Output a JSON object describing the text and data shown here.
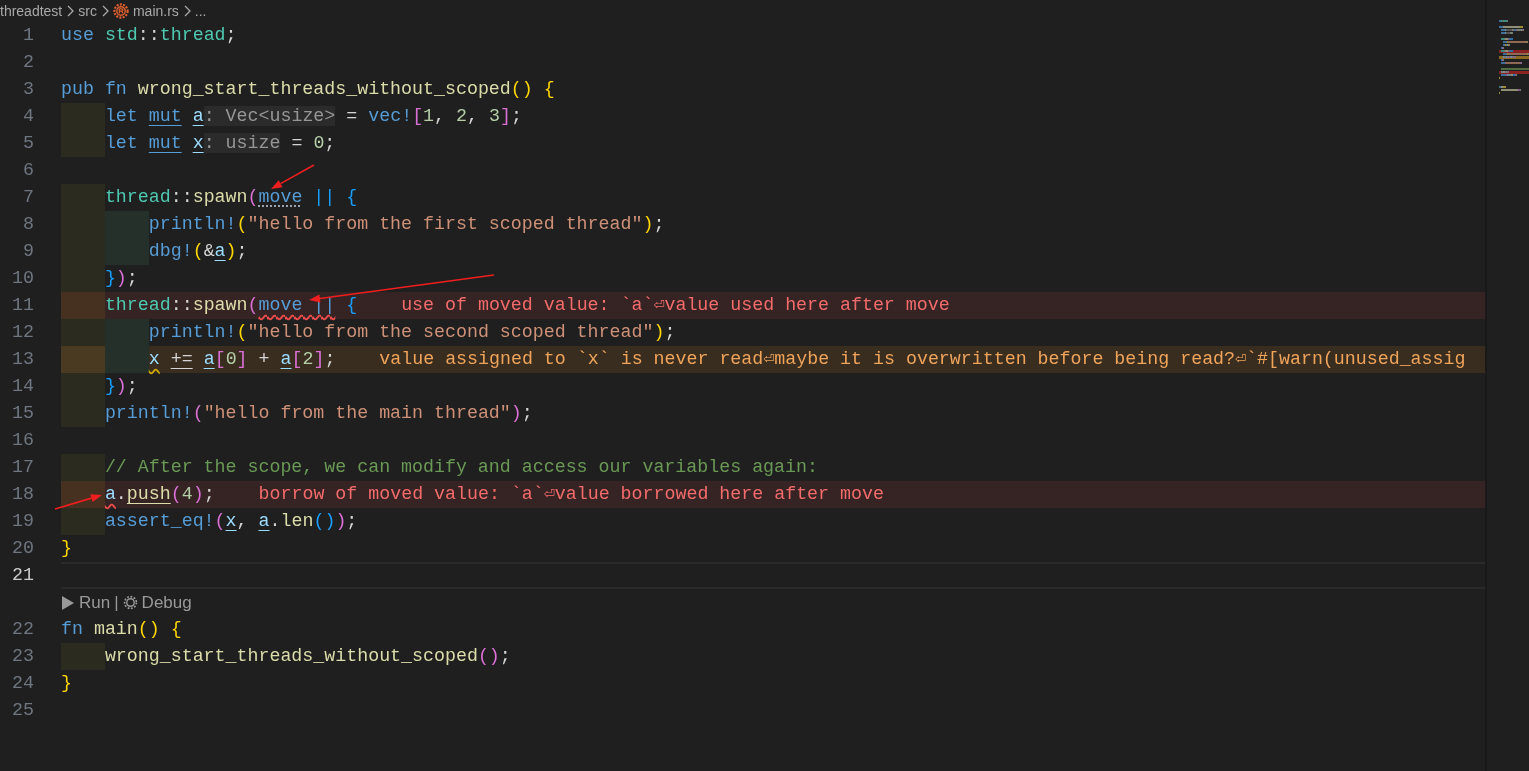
{
  "breadcrumb": [
    {
      "text": "threadtest",
      "kind": "root"
    },
    {
      "text": "src",
      "kind": "plain"
    },
    {
      "text": "main.rs",
      "kind": "rust"
    },
    {
      "text": "...",
      "kind": "plain"
    }
  ],
  "lines": [
    {
      "kind": "code",
      "number": "1",
      "current": false,
      "tokens": [
        {
          "text": "use ",
          "kind": "kw"
        },
        {
          "text": "std",
          "kind": "ns"
        },
        {
          "text": "::",
          "kind": "p"
        },
        {
          "text": "thread",
          "kind": "ns"
        },
        {
          "text": ";",
          "kind": "p"
        }
      ]
    },
    {
      "kind": "code",
      "number": "2",
      "current": false
    },
    {
      "kind": "code",
      "number": "3",
      "current": false,
      "tokens": [
        {
          "text": "pub fn ",
          "kind": "kw"
        },
        {
          "text": "wrong_start_threads_without_scoped",
          "kind": "fn"
        },
        {
          "text": "(",
          "kind": "b1"
        },
        {
          "text": ")",
          "kind": "b1"
        },
        {
          "text": " {",
          "kind": "b1"
        }
      ]
    },
    {
      "kind": "code",
      "number": "4",
      "current": false,
      "indent_guides": [
        {
          "color": "#2c2b20"
        }
      ],
      "tokens": [
        {
          "text": "let ",
          "kind": "kw"
        },
        {
          "text": "mut ",
          "kind": "kw",
          "decoration": {
            "kind": "underline"
          }
        },
        {
          "text": "a",
          "kind": "var",
          "decoration": {
            "kind": "underline"
          }
        },
        {
          "text": ": Vec<usize>",
          "kind": "hint"
        },
        {
          "text": " = ",
          "kind": "p"
        },
        {
          "text": "vec!",
          "kind": "mac"
        },
        {
          "text": "[",
          "kind": "b2"
        },
        {
          "text": "1",
          "kind": "num"
        },
        {
          "text": ", ",
          "kind": "p"
        },
        {
          "text": "2",
          "kind": "num"
        },
        {
          "text": ", ",
          "kind": "p"
        },
        {
          "text": "3",
          "kind": "num"
        },
        {
          "text": "]",
          "kind": "b2"
        },
        {
          "text": ";",
          "kind": "p"
        }
      ]
    },
    {
      "kind": "code",
      "number": "5",
      "current": false,
      "indent_guides": [
        {
          "color": "#2c2b20"
        }
      ],
      "tokens": [
        {
          "text": "let ",
          "kind": "kw"
        },
        {
          "text": "mut ",
          "kind": "kw",
          "decoration": {
            "kind": "underline"
          }
        },
        {
          "text": "x",
          "kind": "var",
          "decoration": {
            "kind": "underline"
          }
        },
        {
          "text": ": usize",
          "kind": "hint"
        },
        {
          "text": " = ",
          "kind": "p"
        },
        {
          "text": "0",
          "kind": "num"
        },
        {
          "text": ";",
          "kind": "p"
        }
      ]
    },
    {
      "kind": "code",
      "number": "6",
      "current": false
    },
    {
      "kind": "code",
      "number": "7",
      "current": false,
      "indent_guides": [
        {
          "color": "#2c2b20"
        }
      ],
      "tokens": [
        {
          "text": "thread",
          "kind": "ns"
        },
        {
          "text": "::",
          "kind": "p"
        },
        {
          "text": "spawn",
          "kind": "fn"
        },
        {
          "text": "(",
          "kind": "b2"
        },
        {
          "text": "move",
          "kind": "kw",
          "decoration": {
            "kind": "dots"
          },
          "arrow": true
        },
        {
          "text": " ||",
          "kind": "b3"
        },
        {
          "text": " {",
          "kind": "b3"
        }
      ]
    },
    {
      "kind": "code",
      "number": "8",
      "current": false,
      "indent_guides": [
        {
          "color": "#2c2b20"
        },
        {
          "color": "#25302a"
        }
      ],
      "tokens": [
        {
          "text": "println!",
          "kind": "mac"
        },
        {
          "text": "(",
          "kind": "b1"
        },
        {
          "text": "\"hello from the first scoped thread\"",
          "kind": "str"
        },
        {
          "text": ")",
          "kind": "b1"
        },
        {
          "text": ";",
          "kind": "p"
        }
      ]
    },
    {
      "kind": "code",
      "number": "9",
      "current": false,
      "indent_guides": [
        {
          "color": "#2c2b20"
        },
        {
          "color": "#25302a"
        }
      ],
      "tokens": [
        {
          "text": "dbg!",
          "kind": "mac"
        },
        {
          "text": "(",
          "kind": "b1"
        },
        {
          "text": "&",
          "kind": "p"
        },
        {
          "text": "a",
          "kind": "var",
          "decoration": {
            "kind": "underline"
          }
        },
        {
          "text": ")",
          "kind": "b1"
        },
        {
          "text": ";",
          "kind": "p"
        }
      ]
    },
    {
      "kind": "code",
      "number": "10",
      "current": false,
      "indent_guides": [
        {
          "color": "#2c2b20"
        }
      ],
      "tokens": [
        {
          "text": "}",
          "kind": "b3"
        },
        {
          "text": ")",
          "kind": "b2"
        },
        {
          "text": ";",
          "kind": "p"
        }
      ]
    },
    {
      "kind": "code",
      "number": "11",
      "current": false,
      "indent_guides": [
        {
          "color": "#46301f"
        }
      ],
      "diagnostic": {
        "kind": "error",
        "message": "use of moved value: `a`⏎value used here after move"
      },
      "tokens": [
        {
          "text": "thread",
          "kind": "ns"
        },
        {
          "text": "::",
          "kind": "p"
        },
        {
          "text": "spawn",
          "kind": "fn"
        },
        {
          "text": "(",
          "kind": "b2"
        },
        {
          "text": "move ||",
          "kind": "kw",
          "decoration": {
            "kind": "error-squiggle"
          },
          "arrow": true
        },
        {
          "text": " {",
          "kind": "b3"
        }
      ]
    },
    {
      "kind": "code",
      "number": "12",
      "current": false,
      "indent_guides": [
        {
          "color": "#2c2b20"
        },
        {
          "color": "#25302a"
        }
      ],
      "tokens": [
        {
          "text": "println!",
          "kind": "mac"
        },
        {
          "text": "(",
          "kind": "b1"
        },
        {
          "text": "\"hello from the second scoped thread\"",
          "kind": "str"
        },
        {
          "text": ")",
          "kind": "b1"
        },
        {
          "text": ";",
          "kind": "p"
        }
      ]
    },
    {
      "kind": "code",
      "number": "13",
      "current": false,
      "indent_guides": [
        {
          "color": "#4a3a22"
        },
        {
          "color": "#25302a"
        }
      ],
      "diagnostic": {
        "kind": "warning",
        "message": "value assigned to `x` is never read⏎maybe it is overwritten before being read?⏎`#[warn(unused_assig"
      },
      "tokens": [
        {
          "text": "x",
          "kind": "var",
          "decoration": {
            "kind": "warning-squiggle"
          }
        },
        {
          "text": " +=",
          "kind": "p",
          "decoration": {
            "kind": "underline"
          }
        },
        {
          "text": " a",
          "kind": "var",
          "decoration": {
            "kind": "underline"
          }
        },
        {
          "text": "[",
          "kind": "b2"
        },
        {
          "text": "0",
          "kind": "num"
        },
        {
          "text": "]",
          "kind": "b2"
        },
        {
          "text": " + ",
          "kind": "p"
        },
        {
          "text": "a",
          "kind": "var",
          "decoration": {
            "kind": "underline"
          }
        },
        {
          "text": "[",
          "kind": "b2"
        },
        {
          "text": "2",
          "kind": "num"
        },
        {
          "text": "]",
          "kind": "b2"
        },
        {
          "text": ";",
          "kind": "p"
        }
      ]
    },
    {
      "kind": "code",
      "number": "14",
      "current": false,
      "indent_guides": [
        {
          "color": "#2c2b20"
        }
      ],
      "tokens": [
        {
          "text": "}",
          "kind": "b3"
        },
        {
          "text": ")",
          "kind": "b2"
        },
        {
          "text": ";",
          "kind": "p"
        }
      ]
    },
    {
      "kind": "code",
      "number": "15",
      "current": false,
      "indent_guides": [
        {
          "color": "#2c2b20"
        }
      ],
      "tokens": [
        {
          "text": "println!",
          "kind": "mac"
        },
        {
          "text": "(",
          "kind": "b2"
        },
        {
          "text": "\"hello from the main thread\"",
          "kind": "str"
        },
        {
          "text": ")",
          "kind": "b2"
        },
        {
          "text": ";",
          "kind": "p"
        }
      ]
    },
    {
      "kind": "code",
      "number": "16",
      "current": false
    },
    {
      "kind": "code",
      "number": "17",
      "current": false,
      "indent_guides": [
        {
          "color": "#2c2b20"
        }
      ],
      "tokens": [
        {
          "text": "// After the scope, we can modify and access our variables again:",
          "kind": "cmt"
        }
      ]
    },
    {
      "kind": "code",
      "number": "18",
      "current": false,
      "indent_guides": [
        {
          "color": "#46301f"
        }
      ],
      "diagnostic": {
        "kind": "error",
        "message": "borrow of moved value: `a`⏎value borrowed here after move"
      },
      "tokens": [
        {
          "text": "a",
          "kind": "var",
          "decoration": {
            "kind": "error-squiggle"
          },
          "arrow": true
        },
        {
          "text": ".",
          "kind": "p"
        },
        {
          "text": "push",
          "kind": "fn",
          "decoration": {
            "kind": "underline"
          }
        },
        {
          "text": "(",
          "kind": "b2"
        },
        {
          "text": "4",
          "kind": "num"
        },
        {
          "text": ")",
          "kind": "b2"
        },
        {
          "text": ";",
          "kind": "p"
        }
      ]
    },
    {
      "kind": "code",
      "number": "19",
      "current": false,
      "indent_guides": [
        {
          "color": "#2c2b20"
        }
      ],
      "tokens": [
        {
          "text": "assert_eq!",
          "kind": "mac"
        },
        {
          "text": "(",
          "kind": "b2"
        },
        {
          "text": "x",
          "kind": "var",
          "decoration": {
            "kind": "underline"
          }
        },
        {
          "text": ", ",
          "kind": "p"
        },
        {
          "text": "a",
          "kind": "var",
          "decoration": {
            "kind": "underline"
          }
        },
        {
          "text": ".",
          "kind": "p"
        },
        {
          "text": "len",
          "kind": "fn"
        },
        {
          "text": "(",
          "kind": "b3"
        },
        {
          "text": ")",
          "kind": "b3"
        },
        {
          "text": ")",
          "kind": "b2"
        },
        {
          "text": ";",
          "kind": "p"
        }
      ]
    },
    {
      "kind": "code",
      "number": "20",
      "current": false,
      "tokens": [
        {
          "text": "}",
          "kind": "b1"
        }
      ]
    },
    {
      "kind": "code",
      "number": "21",
      "current": true
    },
    {
      "kind": "codelens",
      "run": "Run",
      "separator": "|",
      "debug": "Debug"
    },
    {
      "kind": "code",
      "number": "22",
      "current": false,
      "tokens": [
        {
          "text": "fn ",
          "kind": "kw"
        },
        {
          "text": "main",
          "kind": "fn"
        },
        {
          "text": "(",
          "kind": "b1"
        },
        {
          "text": ")",
          "kind": "b1"
        },
        {
          "text": " {",
          "kind": "b1"
        }
      ]
    },
    {
      "kind": "code",
      "number": "23",
      "current": false,
      "indent_guides": [
        {
          "color": "#2c2b20"
        }
      ],
      "tokens": [
        {
          "text": "wrong_start_threads_without_scoped",
          "kind": "fn"
        },
        {
          "text": "(",
          "kind": "b2"
        },
        {
          "text": ")",
          "kind": "b2"
        },
        {
          "text": ";",
          "kind": "p"
        }
      ]
    },
    {
      "kind": "code",
      "number": "24",
      "current": false,
      "tokens": [
        {
          "text": "}",
          "kind": "b1"
        }
      ]
    },
    {
      "kind": "code",
      "number": "25",
      "current": false
    }
  ]
}
